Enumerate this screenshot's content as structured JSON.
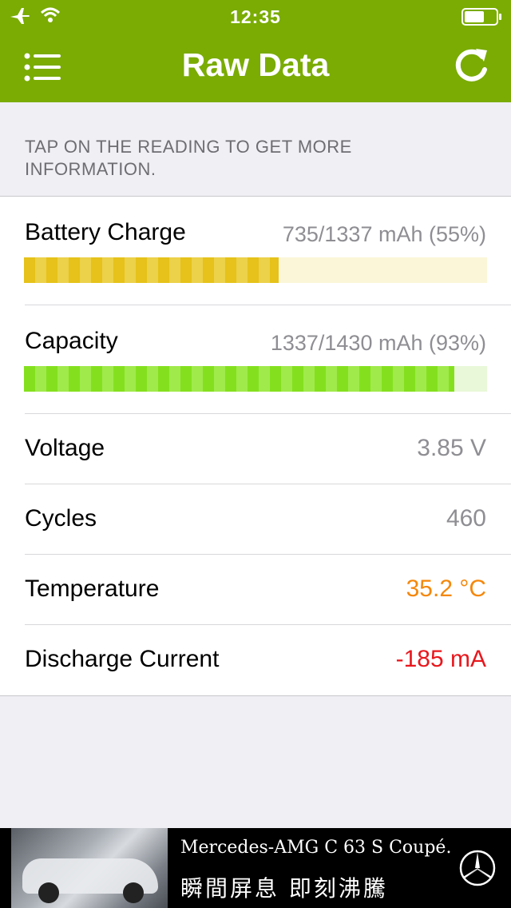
{
  "status_bar": {
    "time": "12:35",
    "icons": [
      "airplane-icon",
      "wifi-icon",
      "battery-icon"
    ]
  },
  "nav": {
    "title": "Raw Data",
    "left_icon": "menu-list-icon",
    "right_icon": "refresh-icon"
  },
  "hint": "TAP ON THE READING TO GET MORE INFORMATION.",
  "readings": {
    "battery_charge": {
      "label": "Battery Charge",
      "value": "735/1337 mAh (55%)",
      "fraction": 0.55
    },
    "capacity": {
      "label": "Capacity",
      "value": "1337/1430 mAh (93%)",
      "fraction": 0.93
    },
    "voltage": {
      "label": "Voltage",
      "value": "3.85 V"
    },
    "cycles": {
      "label": "Cycles",
      "value": "460"
    },
    "temperature": {
      "label": "Temperature",
      "value": "35.2 °C"
    },
    "discharge_current": {
      "label": "Discharge Current",
      "value": "-185 mA"
    }
  },
  "colors": {
    "accent": "#7aac04",
    "charge_bar": "#e6c21a",
    "capacity_bar": "#84e01e",
    "temperature_value": "#f5870a",
    "discharge_value": "#e8171d"
  },
  "ad": {
    "line1": "Mercedes-AMG C 63 S Coupé.",
    "line2": "瞬間屏息 即刻沸騰",
    "logo_icon": "mercedes-star-icon"
  }
}
